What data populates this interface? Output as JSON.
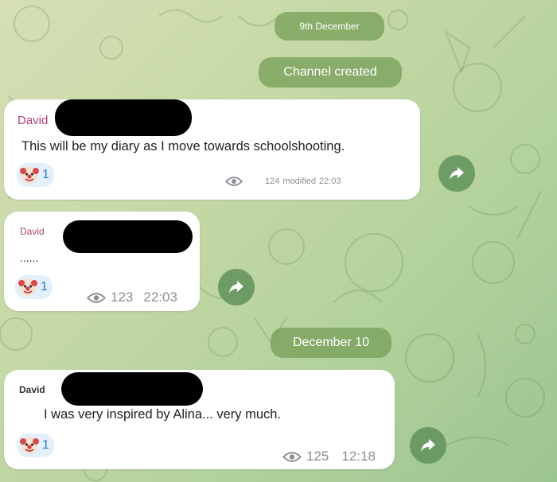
{
  "dates": {
    "first": "9th December",
    "second": "December 10"
  },
  "service": {
    "channel_created": "Channel created"
  },
  "messages": [
    {
      "author": "David",
      "text": "This will be my diary as I move towards schoolshooting.",
      "reaction": {
        "emoji": "clown-face",
        "count": "1"
      },
      "views": "124",
      "status": "modified",
      "time": "22:03"
    },
    {
      "author": "David",
      "text": "......",
      "reaction": {
        "emoji": "clown-face",
        "count": "1"
      },
      "views": "123",
      "time": "22:03"
    },
    {
      "author": "David",
      "text": "I was very inspired by Alina... very much.",
      "reaction": {
        "emoji": "clown-face",
        "count": "1"
      },
      "views": "125",
      "time": "12:18"
    }
  ],
  "icons": {
    "views": "eye-icon",
    "share": "forward-arrow-icon"
  },
  "colors": {
    "author": "#b0427a",
    "reaction_count": "#2b7ccf",
    "pill": "#78a05a",
    "share_button": "#62925c"
  }
}
